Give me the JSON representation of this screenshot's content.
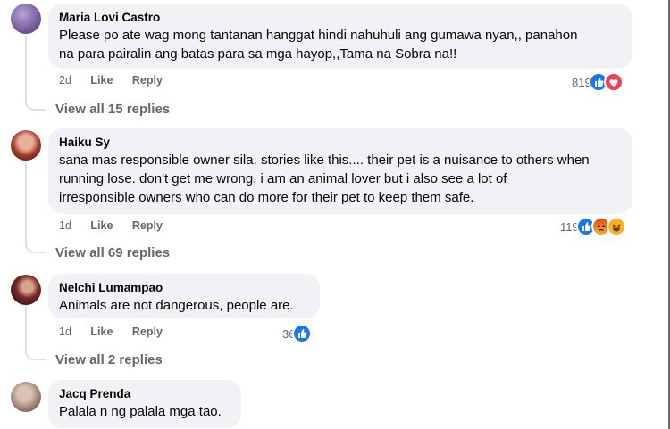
{
  "comments": [
    {
      "author": "Maria Lovi Castro",
      "lines": [
        "Please po ate wag mong tantanan hanggat hindi nahuhuli ang gumawa nyan,, panahon",
        "na para pairalin ang batas para sa mga hayop,,Tama na Sobra na!!"
      ],
      "time": "2d",
      "like": "Like",
      "reply": "Reply",
      "reaction_count": "819",
      "reactions": [
        "like-icon",
        "love-icon"
      ],
      "view_replies": "View all 15 replies"
    },
    {
      "author": "Haiku Sy",
      "lines": [
        "sana mas responsible owner sila. stories like this.... their pet is a nuisance to others when",
        "running lose. don't get me wrong, i am an animal lover but i also see a lot of",
        "irresponsible owners who can do more for their pet to keep them safe."
      ],
      "time": "1d",
      "like": "Like",
      "reply": "Reply",
      "reaction_count": "119",
      "reactions": [
        "like-icon",
        "angry-icon",
        "haha-icon"
      ],
      "view_replies": "View all 69 replies"
    },
    {
      "author": "Nelchi Lumampao",
      "lines": [
        "Animals are not dangerous, people are."
      ],
      "time": "1d",
      "like": "Like",
      "reply": "Reply",
      "reaction_count": "36",
      "reactions": [
        "like-icon"
      ],
      "view_replies": "View all 2 replies"
    },
    {
      "author": "Jacq Prenda",
      "lines": [
        "Palala n ng palala mga tao."
      ]
    }
  ],
  "colors": {
    "bubble": "#f0f2f5",
    "secondary_text": "#65676b",
    "like_blue": "#1877f2",
    "love_red": "#f33e58",
    "angry_orange": "#e9710f",
    "haha_yellow": "#f7b125"
  }
}
